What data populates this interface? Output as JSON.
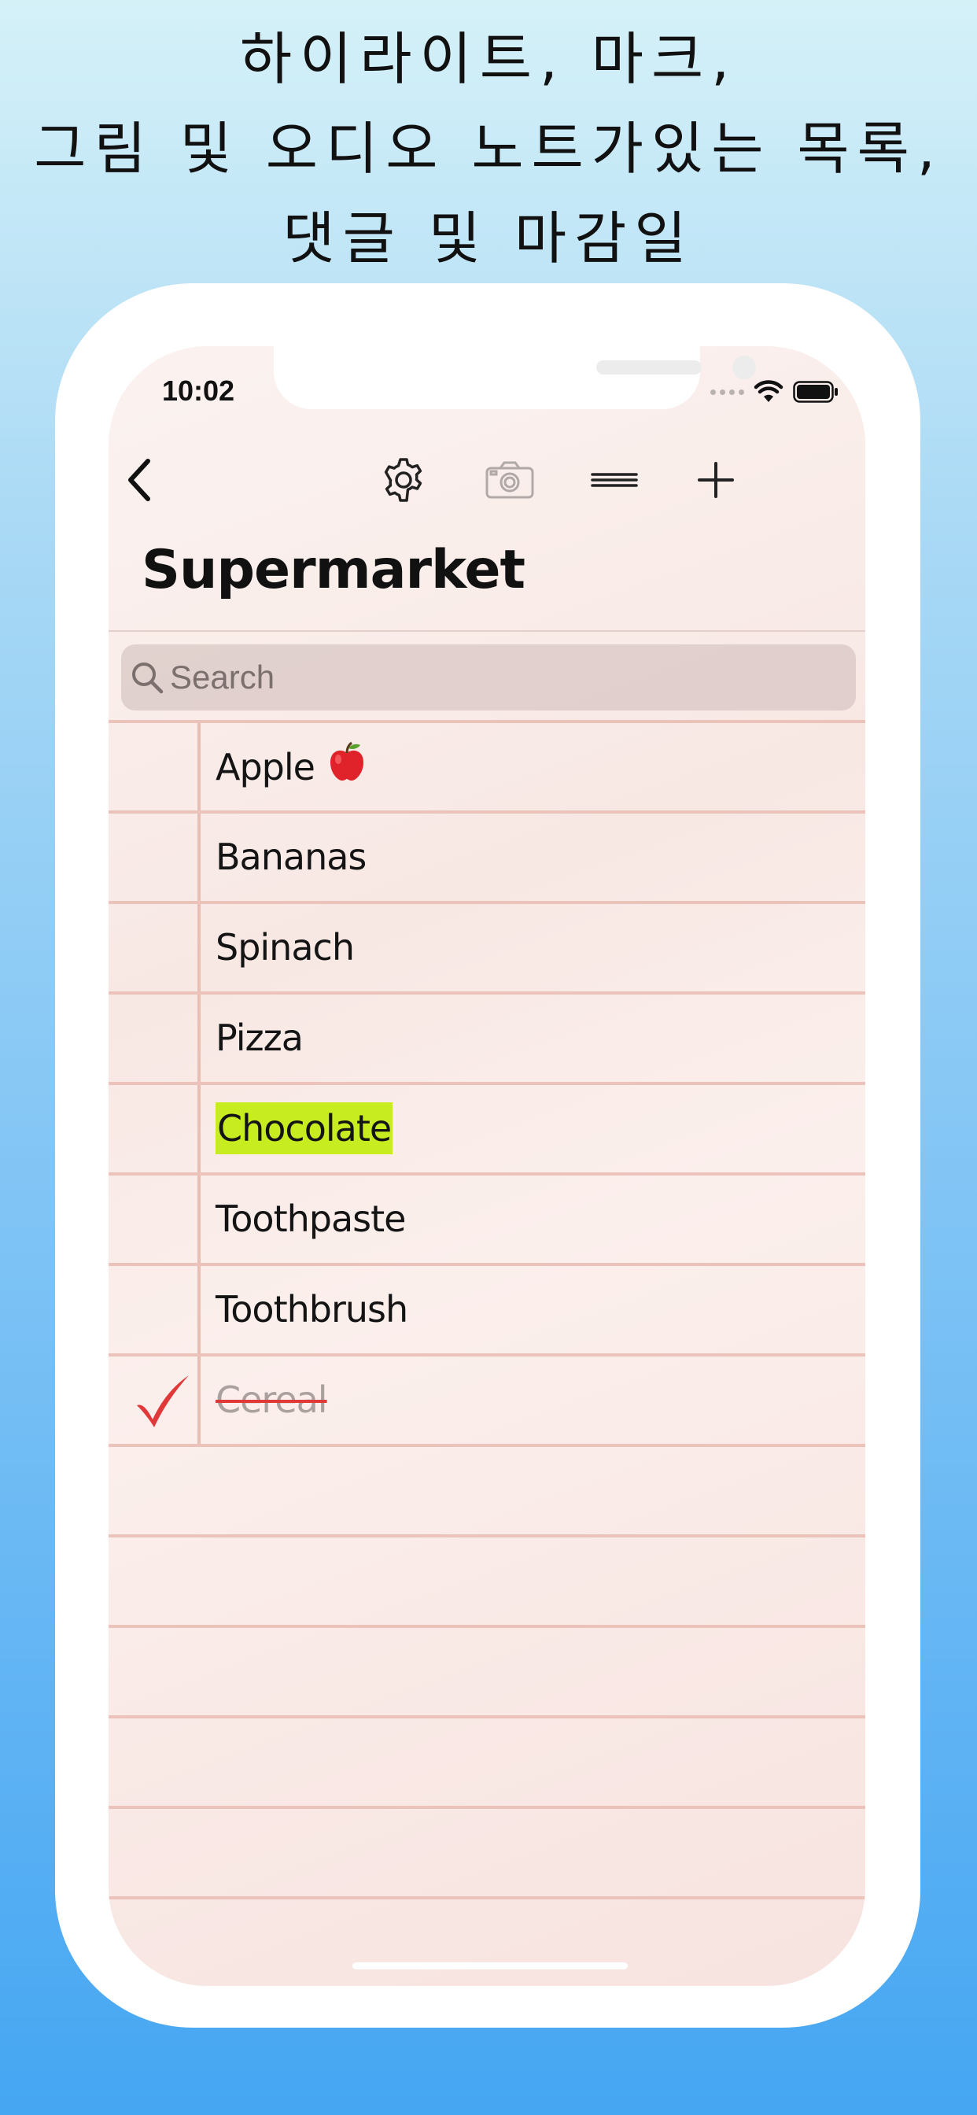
{
  "headline": {
    "line1": "하이라이트, 마크,",
    "line2": "그림 및 오디오 노트가있는 목록,",
    "line3": "댓글 및 마감일"
  },
  "status_bar": {
    "time": "10:02",
    "icons": [
      "cellular-signal-icon",
      "wifi-icon",
      "battery-icon"
    ]
  },
  "nav": {
    "title": "Supermarket",
    "buttons": [
      "back-chevron-icon",
      "settings-gear-icon",
      "camera-icon",
      "reorder-lines-icon",
      "add-plus-icon"
    ]
  },
  "search": {
    "placeholder": "Search",
    "value": ""
  },
  "items": [
    {
      "label": "Apple",
      "emoji": "🍎",
      "checked": false,
      "highlight": false
    },
    {
      "label": "Bananas",
      "checked": false,
      "highlight": false
    },
    {
      "label": "Spinach",
      "checked": false,
      "highlight": false
    },
    {
      "label": "Pizza",
      "checked": false,
      "highlight": false
    },
    {
      "label": "Chocolate",
      "checked": false,
      "highlight": true
    },
    {
      "label": "Toothpaste",
      "checked": false,
      "highlight": false
    },
    {
      "label": "Toothbrush",
      "checked": false,
      "highlight": false
    },
    {
      "label": "Cereal",
      "checked": true,
      "highlight": false
    }
  ],
  "colors": {
    "highlight": "#c7ec20",
    "checkmark": "#e0393a",
    "rule_line": "#ebc3ba",
    "paper": "#f8e8e4"
  }
}
